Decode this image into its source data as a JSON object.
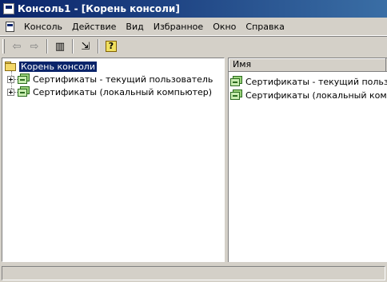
{
  "window": {
    "title": "Консоль1 - [Корень консоли]"
  },
  "menu": {
    "items": [
      {
        "label": "Консоль"
      },
      {
        "label": "Действие"
      },
      {
        "label": "Вид"
      },
      {
        "label": "Избранное"
      },
      {
        "label": "Окно"
      },
      {
        "label": "Справка"
      }
    ]
  },
  "toolbar": {
    "buttons": [
      {
        "icon": "back-arrow-icon",
        "glyph": "⇦",
        "enabled": false
      },
      {
        "icon": "forward-arrow-icon",
        "glyph": "⇨",
        "enabled": false
      },
      {
        "icon": "show-hide-tree-icon",
        "glyph": "▥",
        "enabled": true
      },
      {
        "icon": "export-list-icon",
        "glyph": "⇲",
        "enabled": true
      },
      {
        "icon": "help-icon",
        "glyph": "?",
        "enabled": true
      }
    ]
  },
  "tree": {
    "root": {
      "label": "Корень консоли",
      "icon": "folder-icon",
      "selected": true
    },
    "children": [
      {
        "label": "Сертификаты - текущий пользователь",
        "icon": "certificates-icon"
      },
      {
        "label": "Сертификаты (локальный компьютер)",
        "icon": "certificates-icon"
      }
    ]
  },
  "list": {
    "columns": [
      {
        "label": "Имя"
      }
    ],
    "rows": [
      {
        "name": "Сертификаты - текущий пользова...",
        "icon": "certificates-icon"
      },
      {
        "name": "Сертификаты (локальный комп...",
        "icon": "certificates-icon"
      }
    ]
  },
  "colors": {
    "title_gradient_start": "#0a246a",
    "title_gradient_end": "#3a6ea5",
    "face": "#d4d0c8",
    "selection": "#0a246a"
  }
}
